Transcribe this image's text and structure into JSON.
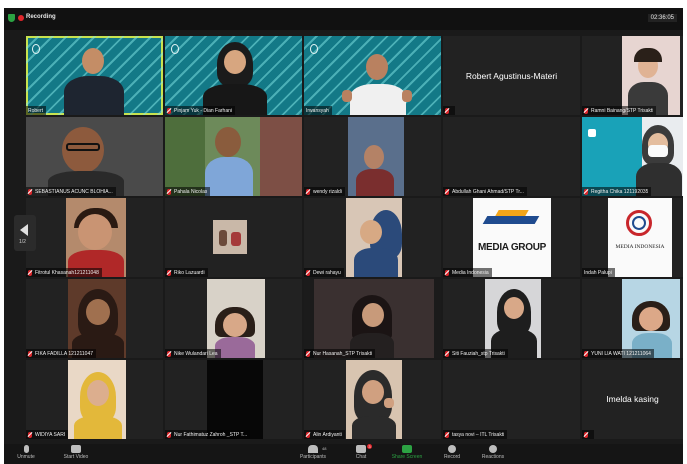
{
  "meeting": {
    "recording_label": "Recording",
    "timer": "02:36:05",
    "page_indicator": "1/2"
  },
  "participants": [
    {
      "name": "Robert",
      "muted": false,
      "active": true
    },
    {
      "name": "Pinjam Yuk - Dian Farhani",
      "muted": true
    },
    {
      "name": "Irwansyah",
      "muted": false
    },
    {
      "name": "Robert Agustinus-Materi",
      "muted": true,
      "video_off": true
    },
    {
      "name": "Ramni Bainang/STP Trisakti",
      "muted": true
    },
    {
      "name": "SEBASTIANUS ACUNC BLOHIA...",
      "muted": true
    },
    {
      "name": "Pahala Nicolas",
      "muted": true
    },
    {
      "name": "wendy rizaldi",
      "muted": true
    },
    {
      "name": "Abdullah Ghani Ahmad/STP Tr...",
      "muted": true,
      "video_off": true
    },
    {
      "name": "Regitha Chika 121192035",
      "muted": true
    },
    {
      "name": "Fitrotul Khasanah121211048",
      "muted": true
    },
    {
      "name": "Riko Lazuardi",
      "muted": true
    },
    {
      "name": "Dewi rahayu",
      "muted": true
    },
    {
      "name": "Media Indonesia",
      "muted": true
    },
    {
      "name": "Indah Palupi",
      "muted": true
    },
    {
      "name": "FIKA FADILLA 121211047",
      "muted": true
    },
    {
      "name": "Nike Wulandari Lea",
      "muted": true
    },
    {
      "name": "Nur Hasanah_STP Trisakti",
      "muted": true
    },
    {
      "name": "Siti Fauziah_stp Trisakti",
      "muted": true
    },
    {
      "name": "YUNI LIA WATI 121211064",
      "muted": true
    },
    {
      "name": "WIDIYA SARI",
      "muted": true
    },
    {
      "name": "Nur Fathimatuz Zahroh _STP T...",
      "muted": true
    },
    {
      "name": "Alin Ardiyanti",
      "muted": true
    },
    {
      "name": "tasya novi – ITL Trisakti",
      "muted": true,
      "video_off": true
    },
    {
      "name": "Imelda kasing",
      "muted": true,
      "video_off": true
    }
  ],
  "logos": {
    "media_group": "MEDIA GROUP",
    "media_indonesia": "MEDIA INDONESIA"
  },
  "controls": {
    "unmute": "Unmute",
    "start_video": "Start Video",
    "participants": "Participants",
    "participants_count": "48",
    "chat": "Chat",
    "chat_badge": "3",
    "share_screen": "Share Screen",
    "record": "Record",
    "reactions": "Reactions"
  },
  "colors": {
    "active_speaker": "#c8e34f",
    "muted_red": "#d9262b",
    "share_green": "#2ca243"
  }
}
